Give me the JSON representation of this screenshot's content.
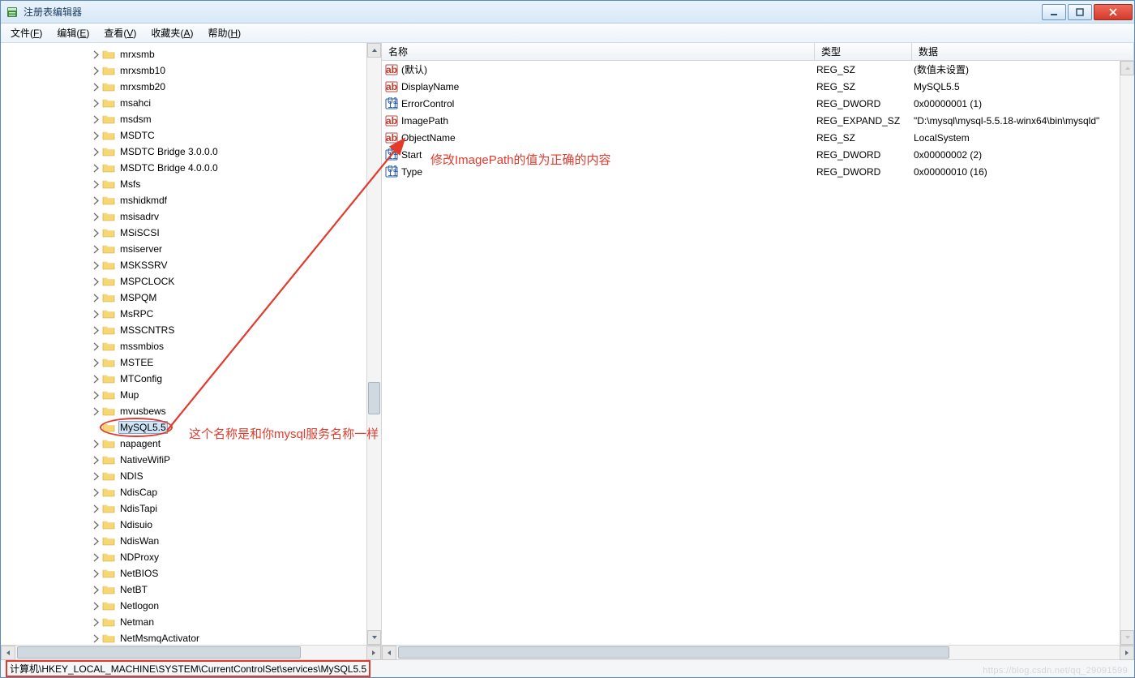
{
  "window": {
    "title": "注册表编辑器"
  },
  "menu": {
    "file": {
      "label": "文件",
      "mnemonic": "F"
    },
    "edit": {
      "label": "编辑",
      "mnemonic": "E"
    },
    "view": {
      "label": "查看",
      "mnemonic": "V"
    },
    "favorites": {
      "label": "收藏夹",
      "mnemonic": "A"
    },
    "help": {
      "label": "帮助",
      "mnemonic": "H"
    }
  },
  "columns": {
    "name": "名称",
    "type": "类型",
    "data": "数据"
  },
  "values": [
    {
      "icon": "string",
      "name": "(默认)",
      "type": "REG_SZ",
      "data": "(数值未设置)"
    },
    {
      "icon": "string",
      "name": "DisplayName",
      "type": "REG_SZ",
      "data": "MySQL5.5"
    },
    {
      "icon": "binary",
      "name": "ErrorControl",
      "type": "REG_DWORD",
      "data": "0x00000001 (1)"
    },
    {
      "icon": "string",
      "name": "ImagePath",
      "type": "REG_EXPAND_SZ",
      "data": "\"D:\\mysql\\mysql-5.5.18-winx64\\bin\\mysqld\""
    },
    {
      "icon": "string",
      "name": "ObjectName",
      "type": "REG_SZ",
      "data": "LocalSystem"
    },
    {
      "icon": "binary",
      "name": "Start",
      "type": "REG_DWORD",
      "data": "0x00000002 (2)"
    },
    {
      "icon": "binary",
      "name": "Type",
      "type": "REG_DWORD",
      "data": "0x00000010 (16)"
    }
  ],
  "tree": [
    {
      "label": "mrxsmb",
      "expanded": false
    },
    {
      "label": "mrxsmb10",
      "expanded": false
    },
    {
      "label": "mrxsmb20",
      "expanded": false
    },
    {
      "label": "msahci",
      "expanded": false
    },
    {
      "label": "msdsm",
      "expanded": false
    },
    {
      "label": "MSDTC",
      "expanded": false
    },
    {
      "label": "MSDTC Bridge 3.0.0.0",
      "expanded": false
    },
    {
      "label": "MSDTC Bridge 4.0.0.0",
      "expanded": false
    },
    {
      "label": "Msfs",
      "expanded": false
    },
    {
      "label": "mshidkmdf",
      "expanded": false
    },
    {
      "label": "msisadrv",
      "expanded": false
    },
    {
      "label": "MSiSCSI",
      "expanded": false
    },
    {
      "label": "msiserver",
      "expanded": false
    },
    {
      "label": "MSKSSRV",
      "expanded": false
    },
    {
      "label": "MSPCLOCK",
      "expanded": false
    },
    {
      "label": "MSPQM",
      "expanded": false
    },
    {
      "label": "MsRPC",
      "expanded": false
    },
    {
      "label": "MSSCNTRS",
      "expanded": false
    },
    {
      "label": "mssmbios",
      "expanded": false
    },
    {
      "label": "MSTEE",
      "expanded": false
    },
    {
      "label": "MTConfig",
      "expanded": false
    },
    {
      "label": "Mup",
      "expanded": false
    },
    {
      "label": "mvusbews",
      "expanded": false
    },
    {
      "label": "MySQL5.5",
      "expanded": null,
      "selected": true
    },
    {
      "label": "napagent",
      "expanded": false
    },
    {
      "label": "NativeWifiP",
      "expanded": false
    },
    {
      "label": "NDIS",
      "expanded": false
    },
    {
      "label": "NdisCap",
      "expanded": false
    },
    {
      "label": "NdisTapi",
      "expanded": false
    },
    {
      "label": "Ndisuio",
      "expanded": false
    },
    {
      "label": "NdisWan",
      "expanded": false
    },
    {
      "label": "NDProxy",
      "expanded": false
    },
    {
      "label": "NetBIOS",
      "expanded": false
    },
    {
      "label": "NetBT",
      "expanded": false
    },
    {
      "label": "Netlogon",
      "expanded": false
    },
    {
      "label": "Netman",
      "expanded": false
    },
    {
      "label": "NetMsmqActivator",
      "expanded": false
    }
  ],
  "status_path": "计算机\\HKEY_LOCAL_MACHINE\\SYSTEM\\CurrentControlSet\\services\\MySQL5.5",
  "annotations": {
    "top": "修改ImagePath的值为正确的内容",
    "side": "这个名称是和你mysql服务名称一样"
  },
  "watermark": "https://blog.csdn.net/qq_29091599"
}
